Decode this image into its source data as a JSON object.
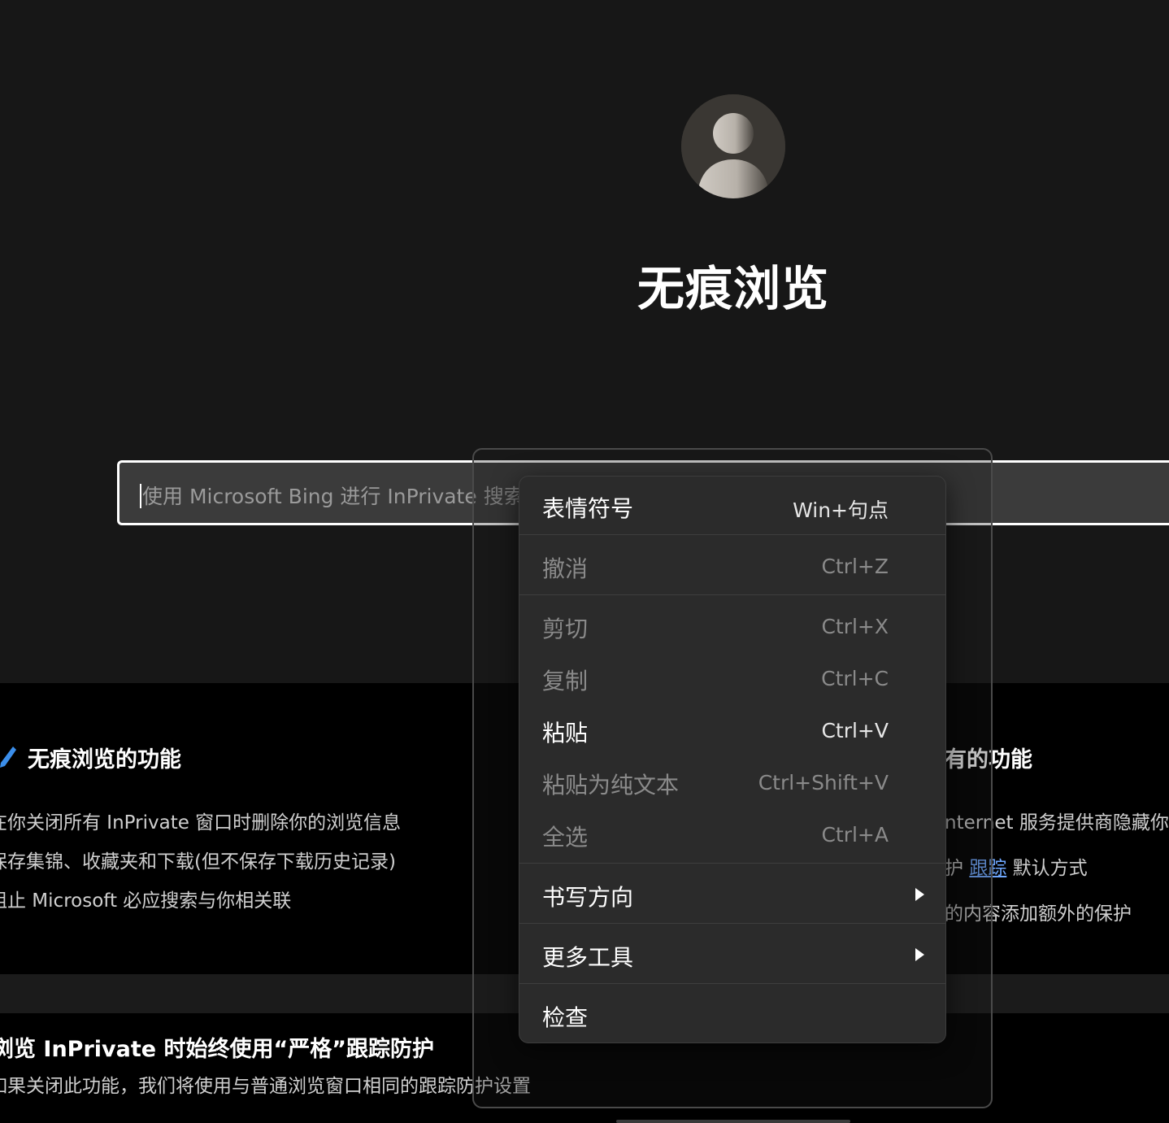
{
  "hero": {
    "title": "无痕浏览"
  },
  "search": {
    "placeholder": "使用 Microsoft Bing 进行 InPrivate 搜索"
  },
  "left_section": {
    "heading": "无痕浏览的功能",
    "lines": [
      "在你关闭所有 InPrivate 窗口时删除你的浏览信息",
      "保存集锦、收藏夹和下载(但不保存下载历史记录)",
      "阻止 Microsoft 必应搜索与你相关联"
    ]
  },
  "right_section": {
    "heading": "有的功能",
    "line1": "nternet 服务提供商隐藏你",
    "line2_prefix": "护",
    "line2_link": "跟踪",
    "line2_suffix": "默认方式",
    "line3": "的内容添加额外的保护"
  },
  "bottom_section": {
    "heading": "浏览 InPrivate 时始终使用“严格”跟踪防护",
    "text": "如果关闭此功能，我们将使用与普通浏览窗口相同的跟踪防护设置"
  },
  "context_menu": {
    "items": [
      {
        "label": "表情符号",
        "shortcut": "Win+句点",
        "disabled": false
      },
      {
        "label": "撤消",
        "shortcut": "Ctrl+Z",
        "disabled": true
      },
      {
        "label": "剪切",
        "shortcut": "Ctrl+X",
        "disabled": true
      },
      {
        "label": "复制",
        "shortcut": "Ctrl+C",
        "disabled": true
      },
      {
        "label": "粘贴",
        "shortcut": "Ctrl+V",
        "disabled": false
      },
      {
        "label": "粘贴为纯文本",
        "shortcut": "Ctrl+Shift+V",
        "disabled": true
      },
      {
        "label": "全选",
        "shortcut": "Ctrl+A",
        "disabled": true
      },
      {
        "label": "书写方向",
        "shortcut": "",
        "disabled": false,
        "submenu": true
      },
      {
        "label": "更多工具",
        "shortcut": "",
        "disabled": false,
        "submenu": true
      },
      {
        "label": "检查",
        "shortcut": "",
        "disabled": false
      }
    ]
  },
  "colors": {
    "background": "#171717",
    "menu_bg": "#2b2b2b",
    "link": "#6fa8ff",
    "disabled_text": "#8a8a8a"
  },
  "icons": {
    "avatar": "person-avatar-icon",
    "pen": "pen-icon",
    "submenu": "chevron-right-icon"
  }
}
